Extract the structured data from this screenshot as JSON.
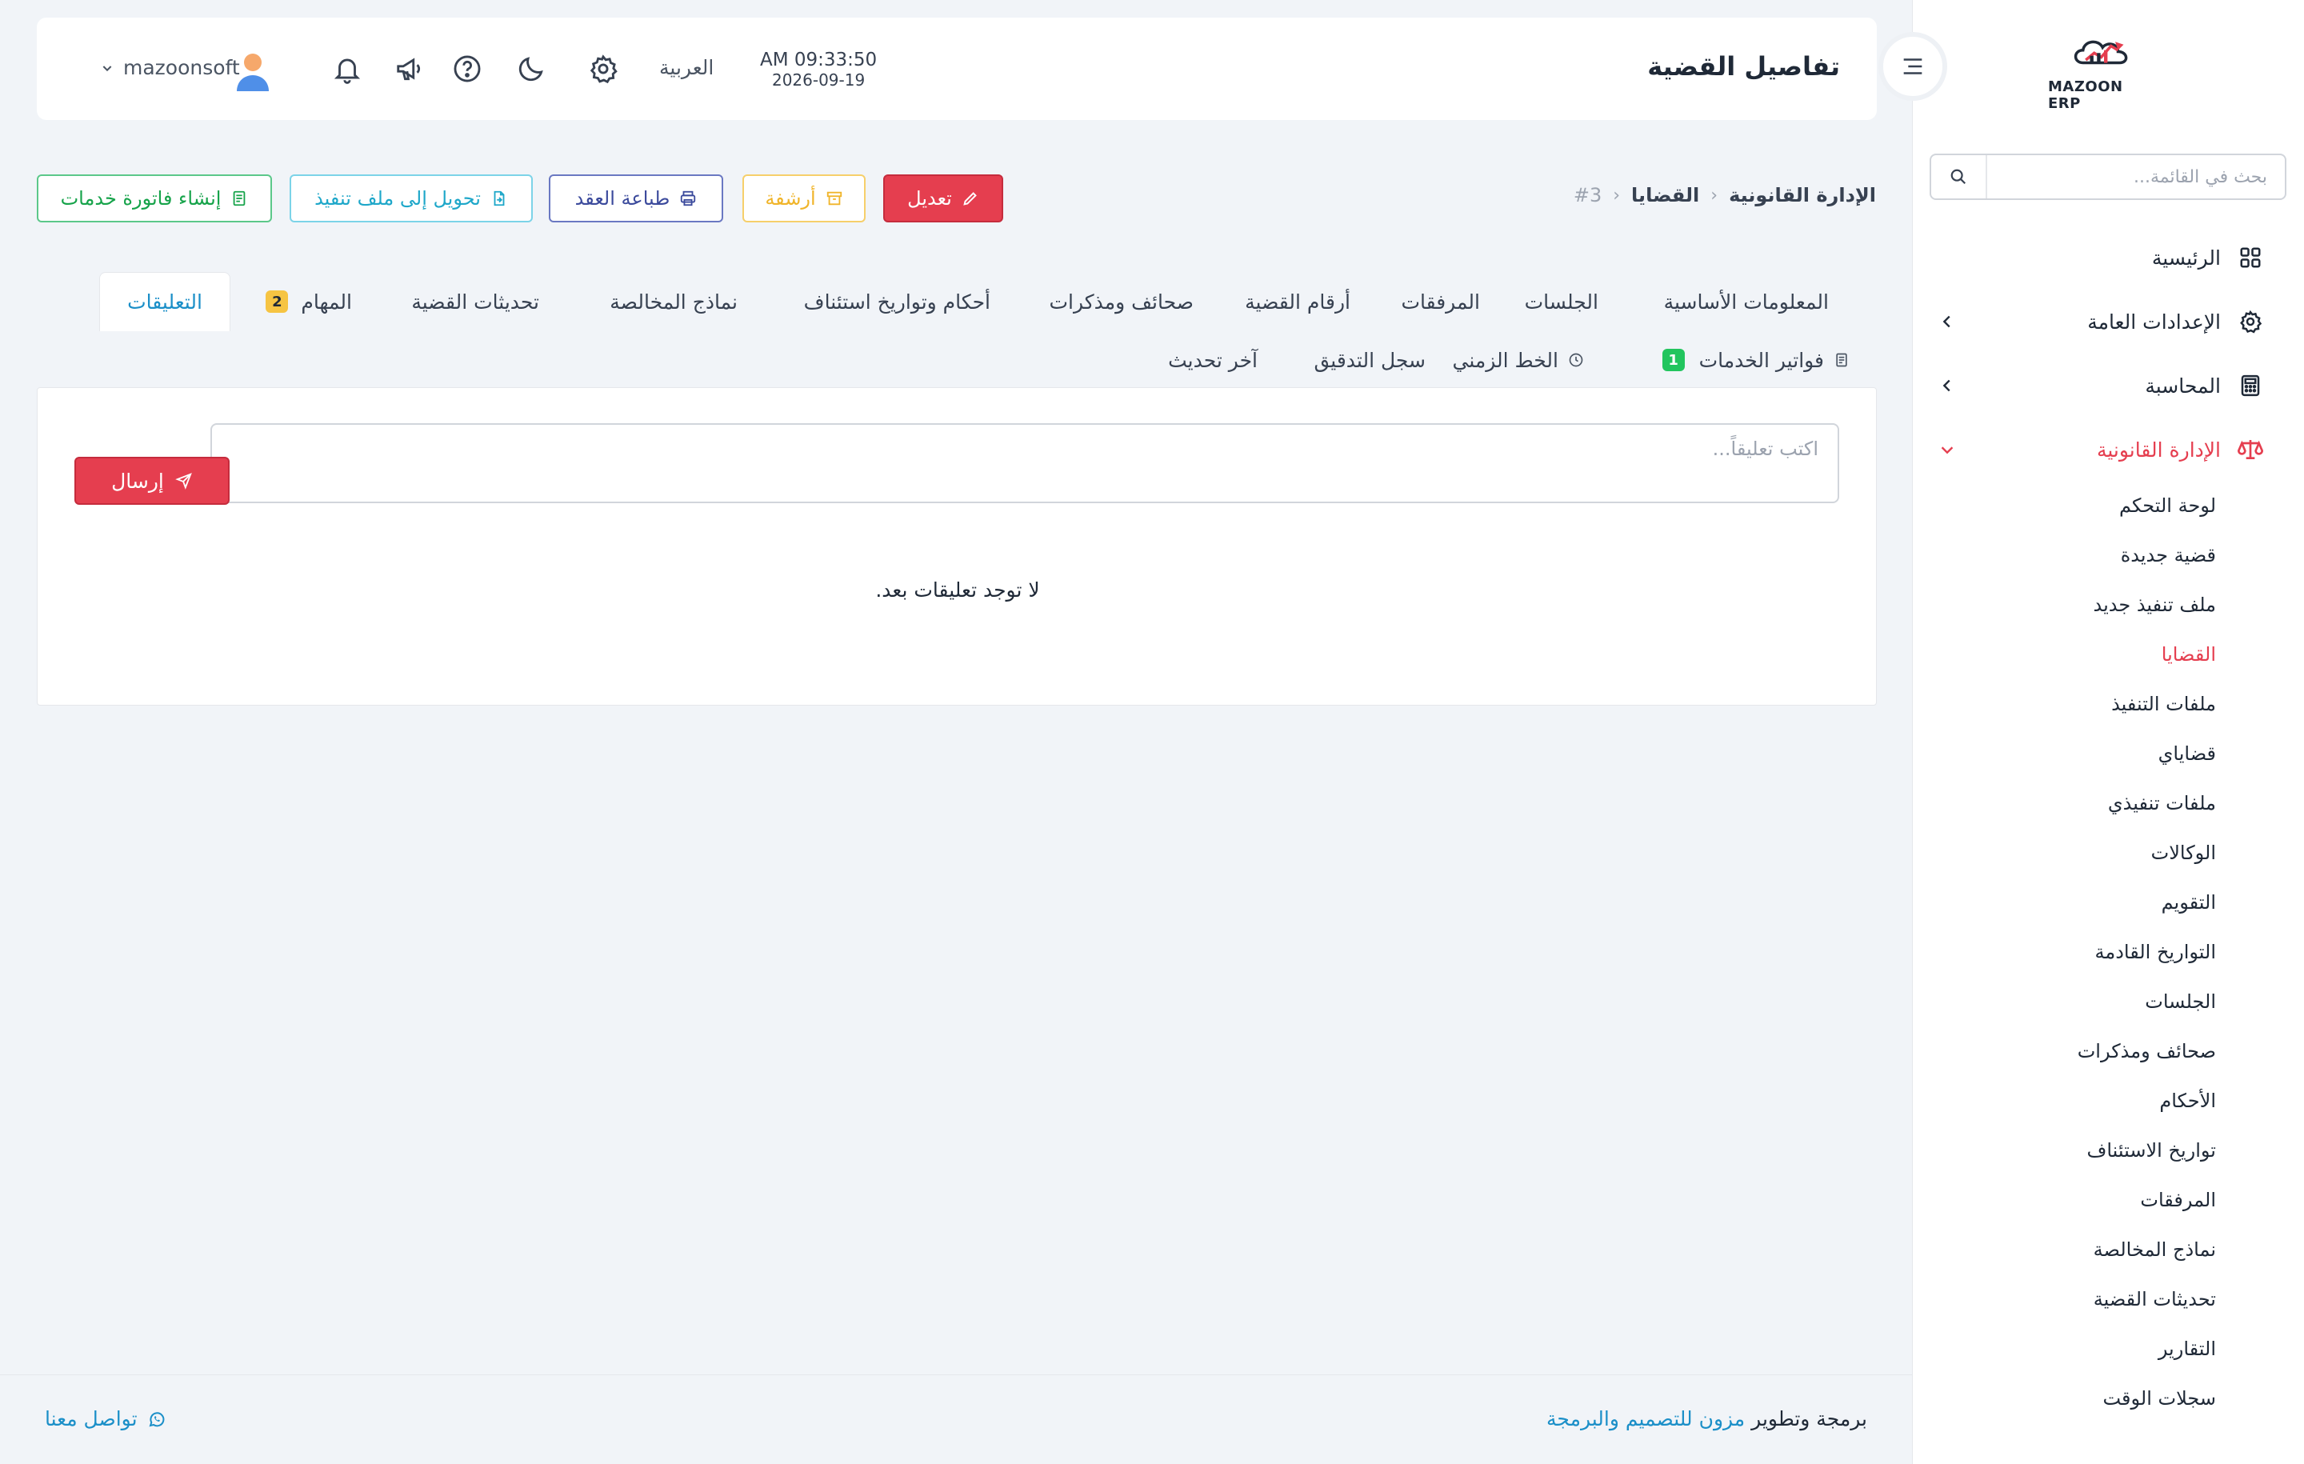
{
  "brand": {
    "name": "MAZOON ERP"
  },
  "sidebar": {
    "search_placeholder": "بحث في القائمة...",
    "items": [
      {
        "label": "الرئيسية"
      },
      {
        "label": "الإعدادات العامة"
      },
      {
        "label": "المحاسبة"
      },
      {
        "label": "الإدارة القانونية"
      }
    ],
    "subitems": [
      {
        "label": "لوحة التحكم"
      },
      {
        "label": "قضية جديدة"
      },
      {
        "label": "ملف تنفيذ جديد"
      },
      {
        "label": "القضايا"
      },
      {
        "label": "ملفات التنفيذ"
      },
      {
        "label": "قضاياي"
      },
      {
        "label": "ملفات تنفيذي"
      },
      {
        "label": "الوكالات"
      },
      {
        "label": "التقويم"
      },
      {
        "label": "التواريخ القادمة"
      },
      {
        "label": "الجلسات"
      },
      {
        "label": "صحائف ومذكرات"
      },
      {
        "label": "الأحكام"
      },
      {
        "label": "تواريخ الاستئناف"
      },
      {
        "label": "المرفقات"
      },
      {
        "label": "نماذج المخالصة"
      },
      {
        "label": "تحديثات القضية"
      },
      {
        "label": "التقارير"
      },
      {
        "label": "سجلات الوقت"
      }
    ],
    "active_color": "#e53e4f"
  },
  "header": {
    "title": "تفاصيل القضية",
    "time": "AM 09:33:50",
    "date": "2026-09-19",
    "language": "العربية",
    "username": "mazoonsoft"
  },
  "breadcrumb": {
    "root": "الإدارة القانونية",
    "section": "القضايا",
    "id": "#3"
  },
  "actions": {
    "edit": "تعديل",
    "archive": "أرشفة",
    "print": "طباعة العقد",
    "convert": "تحويل إلى ملف تنفيذ",
    "invoice": "إنشاء فاتورة خدمات"
  },
  "tabs": {
    "row1": [
      {
        "label": "المعلومات الأساسية"
      },
      {
        "label": "الجلسات"
      },
      {
        "label": "المرفقات"
      },
      {
        "label": "أرقام القضية"
      },
      {
        "label": "صحائف ومذكرات"
      },
      {
        "label": "أحكام وتواريخ استئناف"
      },
      {
        "label": "نماذج المخالصة"
      },
      {
        "label": "تحديثات القضية"
      },
      {
        "label": "المهام",
        "badge": "2"
      },
      {
        "label": "التعليقات"
      }
    ],
    "row2": [
      {
        "label": "فواتير الخدمات",
        "badge": "1"
      },
      {
        "label": "الخط الزمني"
      },
      {
        "label": "سجل التدقيق"
      },
      {
        "label": "آخر تحديث"
      }
    ],
    "active_color": "#1b8fc8"
  },
  "comments": {
    "placeholder": "اكتب تعليقاً...",
    "send": "إرسال",
    "empty": "لا توجد تعليقات بعد."
  },
  "footer": {
    "credit_prefix": "برمجة وتطوير",
    "credit_link": "مزون للتصميم والبرمجة",
    "contact": "تواصل معنا"
  }
}
